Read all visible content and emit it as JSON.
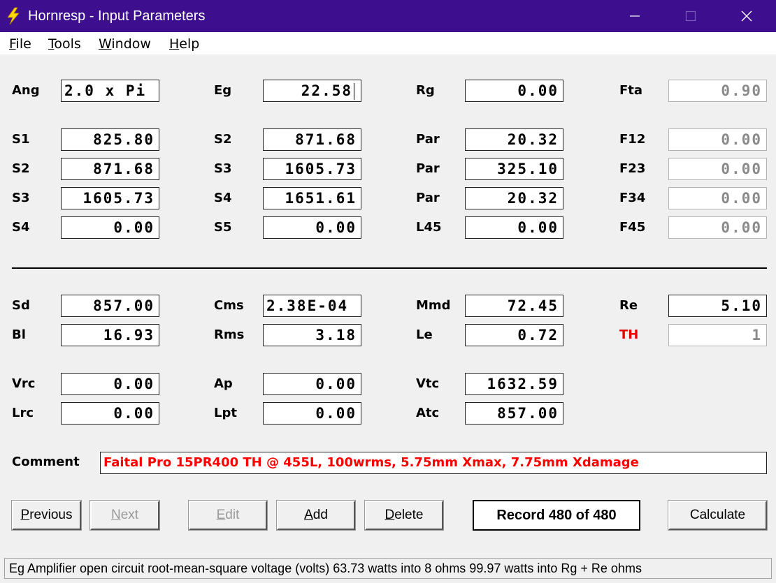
{
  "window": {
    "title": "Hornresp - Input Parameters",
    "icon": "lightning-bolt-icon",
    "title_bar_color": "#3d0f8f",
    "minimize_glyph": "—",
    "maximize_glyph": "☐",
    "close_glyph": "✕"
  },
  "menu": [
    {
      "key": "F",
      "rest": "ile"
    },
    {
      "key": "T",
      "rest": "ools"
    },
    {
      "key": "W",
      "rest": "indow"
    },
    {
      "key": "H",
      "rest": "elp"
    }
  ],
  "params": {
    "ang": {
      "label": "Ang",
      "value": "2.0 x Pi"
    },
    "eg": {
      "label": "Eg",
      "value": "22.58"
    },
    "rg": {
      "label": "Rg",
      "value": "0.00"
    },
    "fta": {
      "label": "Fta",
      "value": "0.90"
    },
    "s1": {
      "label": "S1",
      "value": "825.80"
    },
    "s2_b": {
      "label": "S2",
      "value": "871.68"
    },
    "par1": {
      "label": "Par",
      "value": "20.32"
    },
    "f12": {
      "label": "F12",
      "value": "0.00"
    },
    "s2": {
      "label": "S2",
      "value": "871.68"
    },
    "s3_b": {
      "label": "S3",
      "value": "1605.73"
    },
    "par2": {
      "label": "Par",
      "value": "325.10"
    },
    "f23": {
      "label": "F23",
      "value": "0.00"
    },
    "s3": {
      "label": "S3",
      "value": "1605.73"
    },
    "s4_b": {
      "label": "S4",
      "value": "1651.61"
    },
    "par3": {
      "label": "Par",
      "value": "20.32"
    },
    "f34": {
      "label": "F34",
      "value": "0.00"
    },
    "s4": {
      "label": "S4",
      "value": "0.00"
    },
    "s5": {
      "label": "S5",
      "value": "0.00"
    },
    "l45": {
      "label": "L45",
      "value": "0.00"
    },
    "f45": {
      "label": "F45",
      "value": "0.00"
    },
    "sd": {
      "label": "Sd",
      "value": "857.00"
    },
    "cms": {
      "label": "Cms",
      "value": "2.38E-04"
    },
    "mmd": {
      "label": "Mmd",
      "value": "72.45"
    },
    "re": {
      "label": "Re",
      "value": "5.10"
    },
    "bl": {
      "label": "Bl",
      "value": "16.93"
    },
    "rms": {
      "label": "Rms",
      "value": "3.18"
    },
    "le": {
      "label": "Le",
      "value": "0.72"
    },
    "th": {
      "label": "TH",
      "value": "1"
    },
    "vrc": {
      "label": "Vrc",
      "value": "0.00"
    },
    "ap": {
      "label": "Ap",
      "value": "0.00"
    },
    "vtc": {
      "label": "Vtc",
      "value": "1632.59"
    },
    "lrc": {
      "label": "Lrc",
      "value": "0.00"
    },
    "lpt": {
      "label": "Lpt",
      "value": "0.00"
    },
    "atc": {
      "label": "Atc",
      "value": "857.00"
    }
  },
  "comment": {
    "label": "Comment",
    "value": "Faital Pro 15PR400 TH @ 455L, 100wrms, 5.75mm Xmax, 7.75mm Xdamage"
  },
  "buttons": {
    "previous": {
      "key": "P",
      "rest": "revious"
    },
    "next": {
      "key": "N",
      "rest": "ext"
    },
    "edit": {
      "key": "E",
      "rest": "dit"
    },
    "add": {
      "key": "A",
      "rest": "dd"
    },
    "delete": {
      "key": "D",
      "rest": "elete"
    },
    "calculate": "Calculate"
  },
  "record": "Record 480 of 480",
  "status": "Eg  Amplifier open circuit root-mean-square voltage  (volts)  63.73 watts into 8 ohms   99.97 watts into Rg + Re ohms"
}
